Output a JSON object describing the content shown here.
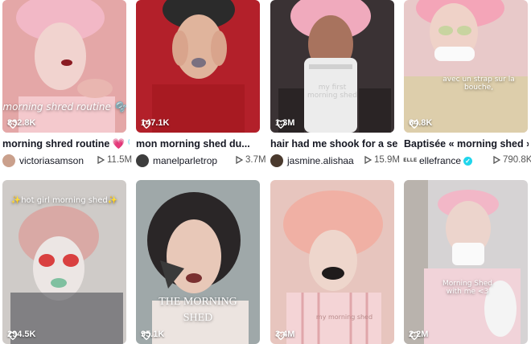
{
  "videos": [
    {
      "title": "morning shred routine 💗 🫧",
      "views": "832.8K",
      "author": "victoriasamson",
      "plays": "11.5M",
      "overlay": "morning shred routine 🫧",
      "colors": {
        "bg": "#d98c8c",
        "accent": "#f2b8c6"
      }
    },
    {
      "title": "mon morning shed du...",
      "views": "147.1K",
      "author": "manelparletrop",
      "plays": "3.7M",
      "overlay": "",
      "colors": {
        "bg": "#b3202a",
        "accent": "#e0b49c"
      }
    },
    {
      "title": "hair had me shook for a sec...",
      "views": "1.3M",
      "author": "jasmine.alishaa",
      "plays": "15.9M",
      "overlay": "my first morning shed",
      "colors": {
        "bg": "#3a3234",
        "accent": "#f0aabd"
      }
    },
    {
      "title": "Baptisée « morning shed »,...",
      "views": "64.8K",
      "author": "ellefrance",
      "plays": "790.8K",
      "overlay": "avec un strap sur la bouche,",
      "verified": true,
      "colors": {
        "bg": "#e8c9c9",
        "accent": "#f4a5b8"
      }
    },
    {
      "title": "",
      "views": "294.5K",
      "overlay": "✨hot girl morning shed✨",
      "colors": {
        "bg": "#cfcbc8",
        "accent": "#d9a9a5"
      }
    },
    {
      "title": "",
      "views": "95.1K",
      "overlay": "THE MORNING SHED",
      "colors": {
        "bg": "#9fa8a9",
        "accent": "#2a2627"
      }
    },
    {
      "title": "",
      "views": "3.4M",
      "overlay": "my morning shed",
      "colors": {
        "bg": "#e7c5be",
        "accent": "#f0b0a4"
      }
    },
    {
      "title": "",
      "views": "2.2M",
      "overlay": "Morning Shed with me <3",
      "colors": {
        "bg": "#d6d3d4",
        "accent": "#f2b7c7"
      }
    }
  ]
}
